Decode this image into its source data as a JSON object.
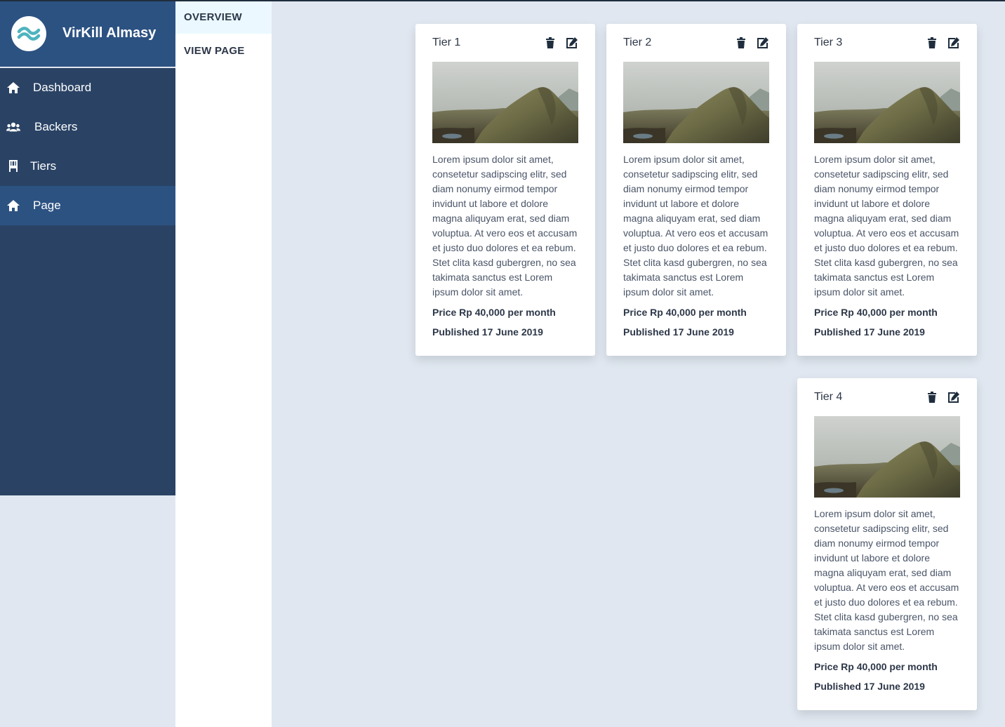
{
  "brand": {
    "name": "VirKill Almasy",
    "logo_icon": "wave-logo-icon"
  },
  "sidebar": {
    "items": [
      {
        "label": "Dashboard",
        "icon": "home-icon"
      },
      {
        "label": "Backers",
        "icon": "users-icon"
      },
      {
        "label": "Tiers",
        "icon": "chair-icon"
      },
      {
        "label": "Page",
        "icon": "home-icon",
        "active": true
      }
    ]
  },
  "subnav": {
    "items": [
      {
        "label": "OVERVIEW",
        "active": true
      },
      {
        "label": "VIEW PAGE"
      }
    ]
  },
  "tiers": [
    {
      "title": "Tier 1",
      "description": "Lorem ipsum dolor sit amet, consetetur sadipscing elitr, sed diam nonumy eirmod tempor invidunt ut labore et dolore magna aliquyam erat, sed diam voluptua. At vero eos et accusam et justo duo dolores et ea rebum. Stet clita kasd gubergren, no sea takimata sanctus est Lorem ipsum dolor sit amet.",
      "price": "Price Rp 40,000 per month",
      "published": "Published 17 June 2019"
    },
    {
      "title": "Tier 2",
      "description": "Lorem ipsum dolor sit amet, consetetur sadipscing elitr, sed diam nonumy eirmod tempor invidunt ut labore et dolore magna aliquyam erat, sed diam voluptua. At vero eos et accusam et justo duo dolores et ea rebum. Stet clita kasd gubergren, no sea takimata sanctus est Lorem ipsum dolor sit amet.",
      "price": "Price Rp 40,000 per month",
      "published": "Published 17 June 2019"
    },
    {
      "title": "Tier 3",
      "description": "Lorem ipsum dolor sit amet, consetetur sadipscing elitr, sed diam nonumy eirmod tempor invidunt ut labore et dolore magna aliquyam erat, sed diam voluptua. At vero eos et accusam et justo duo dolores et ea rebum. Stet clita kasd gubergren, no sea takimata sanctus est Lorem ipsum dolor sit amet.",
      "price": "Price Rp 40,000 per month",
      "published": "Published 17 June 2019"
    },
    {
      "title": "Tier 4",
      "description": "Lorem ipsum dolor sit amet, consetetur sadipscing elitr, sed diam nonumy eirmod tempor invidunt ut labore et dolore magna aliquyam erat, sed diam voluptua. At vero eos et accusam et justo duo dolores et ea rebum. Stet clita kasd gubergren, no sea takimata sanctus est Lorem ipsum dolor sit amet.",
      "price": "Price Rp 40,000 per month",
      "published": "Published 17 June 2019"
    }
  ],
  "card_icons": {
    "delete": "trash-icon",
    "edit": "edit-icon"
  },
  "colors": {
    "sidebar": "#2a4365",
    "sidebar_active": "#2c5282",
    "background": "#e0e7f0",
    "logo_accent": "#4fb3bf"
  }
}
